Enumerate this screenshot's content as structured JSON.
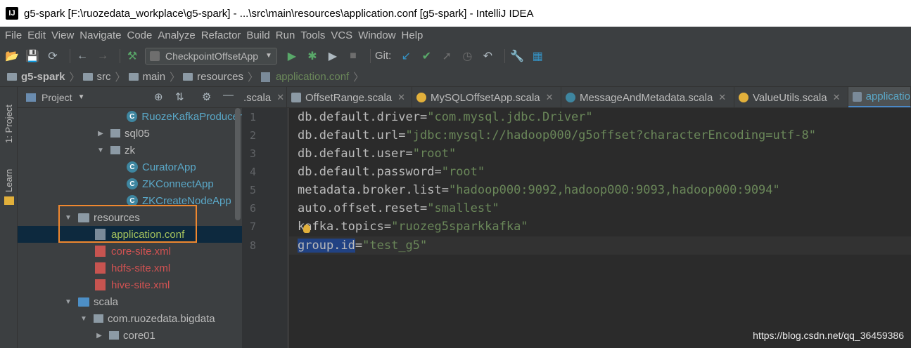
{
  "window": {
    "title": "g5-spark [F:\\ruozedata_workplace\\g5-spark] - ...\\src\\main\\resources\\application.conf [g5-spark] - IntelliJ IDEA",
    "logo_text": "IJ"
  },
  "menu": [
    "File",
    "Edit",
    "View",
    "Navigate",
    "Code",
    "Analyze",
    "Refactor",
    "Build",
    "Run",
    "Tools",
    "VCS",
    "Window",
    "Help"
  ],
  "toolbar": {
    "run_config": "CheckpointOffsetApp",
    "git_label": "Git:"
  },
  "breadcrumb": [
    "g5-spark",
    "src",
    "main",
    "resources",
    "application.conf"
  ],
  "sidebar_tabs": {
    "project": "1: Project",
    "learn": "Learn"
  },
  "project_panel": {
    "title": "Project",
    "tree": [
      {
        "label": "RuozeKafkaProducer",
        "kind": "class"
      },
      {
        "label": "sql05",
        "kind": "package"
      },
      {
        "label": "zk",
        "kind": "package"
      },
      {
        "label": "CuratorApp",
        "kind": "class"
      },
      {
        "label": "ZKConnectApp",
        "kind": "class"
      },
      {
        "label": "ZKCreateNodeApp",
        "kind": "class"
      },
      {
        "label": "resources",
        "kind": "folder"
      },
      {
        "label": "application.conf",
        "kind": "conf"
      },
      {
        "label": "core-site.xml",
        "kind": "xml"
      },
      {
        "label": "hdfs-site.xml",
        "kind": "xml"
      },
      {
        "label": "hive-site.xml",
        "kind": "xml"
      },
      {
        "label": "scala",
        "kind": "folder"
      },
      {
        "label": "com.ruozedata.bigdata",
        "kind": "package"
      },
      {
        "label": "core01",
        "kind": "package"
      }
    ]
  },
  "tabs": [
    {
      "label": ".scala"
    },
    {
      "label": "OffsetRange.scala"
    },
    {
      "label": "MySQLOffsetApp.scala"
    },
    {
      "label": "MessageAndMetadata.scala"
    },
    {
      "label": "ValueUtils.scala"
    },
    {
      "label": "applicatio"
    }
  ],
  "editor": {
    "lines": [
      {
        "n": "1",
        "key": "db.default.driver",
        "eq": "=",
        "val": "\"com.mysql.jdbc.Driver\""
      },
      {
        "n": "2",
        "key": "db.default.url",
        "eq": "=",
        "val": "\"jdbc:mysql://hadoop000/g5offset?characterEncoding=utf-8\""
      },
      {
        "n": "3",
        "key": "db.default.user",
        "eq": "=",
        "val": "\"root\""
      },
      {
        "n": "4",
        "key": "db.default.password",
        "eq": "=",
        "val": "\"root\""
      },
      {
        "n": "5",
        "key": "metadata.broker.list",
        "eq": "=",
        "val": "\"hadoop000:9092,hadoop000:9093,hadoop000:9094\""
      },
      {
        "n": "6",
        "key": "auto.offset.reset",
        "eq": "=",
        "val": "\"smallest\""
      },
      {
        "n": "7",
        "key": "kafka.topics",
        "eq": "=",
        "val": "\"ruozeg5sparkkafka\""
      },
      {
        "n": "8",
        "key": "group.id",
        "eq": "=",
        "val": "\"test_g5\""
      }
    ]
  },
  "watermark": "https://blog.csdn.net/qq_36459386"
}
